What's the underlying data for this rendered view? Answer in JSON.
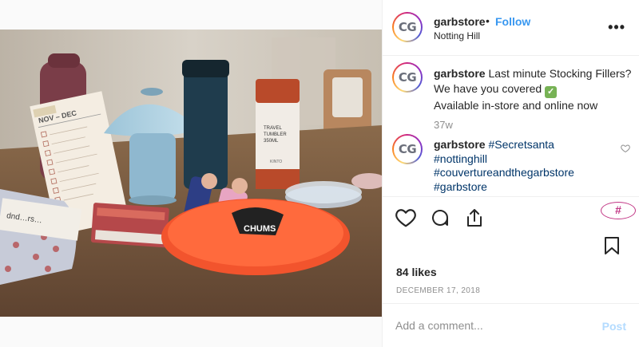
{
  "post": {
    "image_alt": "",
    "image_texts": {
      "calendar_heading": "NOV – DEC",
      "tumbler_label_1": "TRAVEL",
      "tumbler_label_2": "TUMBLER",
      "tumbler_label_3": "350ML",
      "tumbler_brand": "KINTO",
      "frisbee_text": "CHUMS",
      "card_text": "dnd…rs…"
    }
  },
  "header": {
    "avatar_initials": "CG",
    "username": "garbstore",
    "separator": "•",
    "follow_label": "Follow",
    "location": "Notting Hill",
    "more_icon": "more-options-icon",
    "more_label": "•••"
  },
  "caption": {
    "avatar_initials": "CG",
    "username": "garbstore",
    "line1": "Last minute Stocking Fillers?",
    "line2": "We have you covered",
    "check_icon": "check-mark-emoji",
    "check_glyph": "✓",
    "line3": "Available in-store and online now",
    "time_ago": "37w"
  },
  "comment": {
    "avatar_initials": "CG",
    "username": "garbstore",
    "tags": [
      "#Secretsanta",
      "#nottinghill",
      "#couvertureandthegarbstore",
      "#garbstore"
    ],
    "like_icon": "heart-outline-icon"
  },
  "actions": {
    "like_icon": "heart-icon",
    "comment_icon": "comment-icon",
    "share_icon": "share-icon",
    "save_icon": "bookmark-icon",
    "hashtag_badge": "#",
    "likes_text": "84 likes",
    "date_text": "DECEMBER 17, 2018"
  },
  "add_comment": {
    "placeholder": "Add a comment...",
    "post_label": "Post"
  },
  "colors": {
    "link_blue": "#3897f0",
    "hashtag_blue": "#003569",
    "secondary_gray": "#8e8e8e",
    "post_disabled": "#b3dbff",
    "badge_magenta": "#c13584",
    "check_green": "#77b255"
  }
}
